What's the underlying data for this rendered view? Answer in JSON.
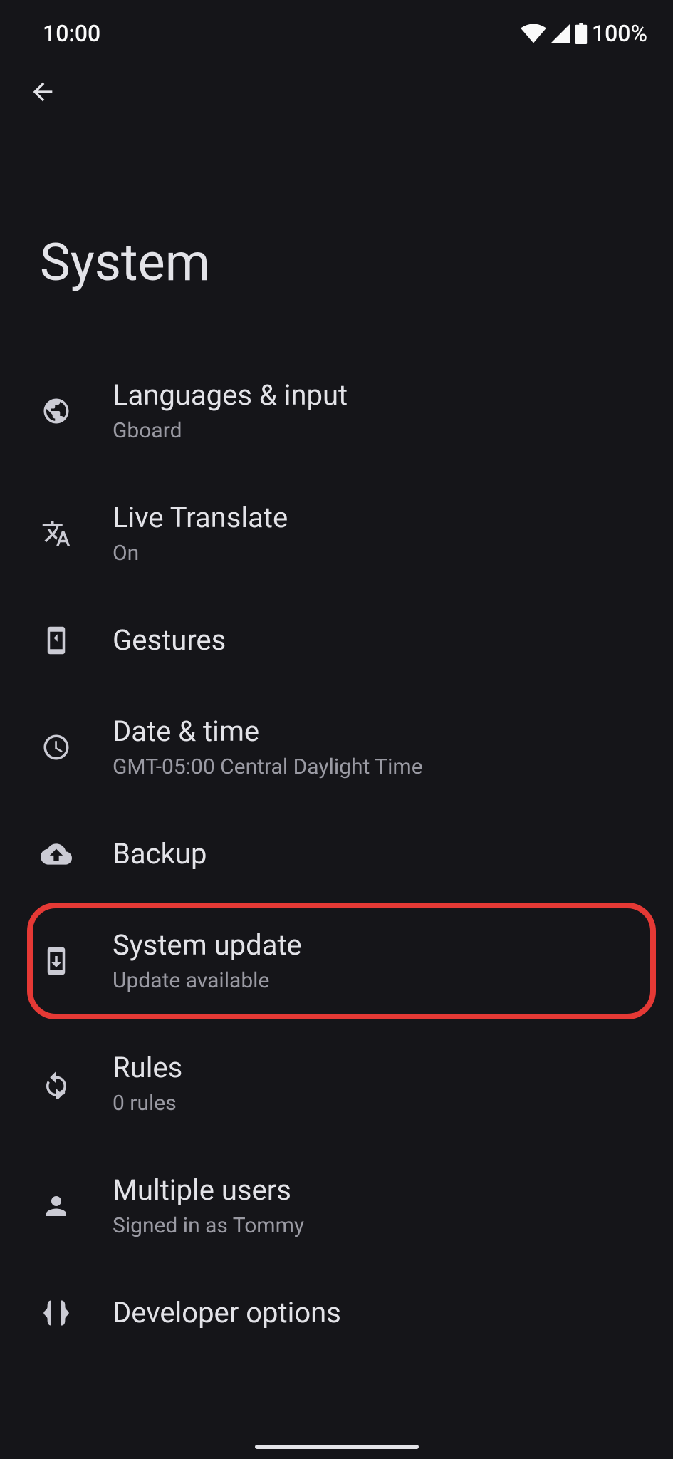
{
  "status_bar": {
    "time": "10:00",
    "battery": "100%"
  },
  "page": {
    "title": "System"
  },
  "menu": {
    "items": [
      {
        "icon": "globe-icon",
        "title": "Languages & input",
        "subtitle": "Gboard"
      },
      {
        "icon": "translate-icon",
        "title": "Live Translate",
        "subtitle": "On"
      },
      {
        "icon": "gesture-icon",
        "title": "Gestures",
        "subtitle": ""
      },
      {
        "icon": "clock-icon",
        "title": "Date & time",
        "subtitle": "GMT-05:00 Central Daylight Time"
      },
      {
        "icon": "cloud-upload-icon",
        "title": "Backup",
        "subtitle": ""
      },
      {
        "icon": "system-update-icon",
        "title": "System update",
        "subtitle": "Update available",
        "highlighted": true
      },
      {
        "icon": "rules-icon",
        "title": "Rules",
        "subtitle": "0 rules"
      },
      {
        "icon": "person-icon",
        "title": "Multiple users",
        "subtitle": "Signed in as Tommy"
      },
      {
        "icon": "braces-icon",
        "title": "Developer options",
        "subtitle": ""
      }
    ]
  }
}
